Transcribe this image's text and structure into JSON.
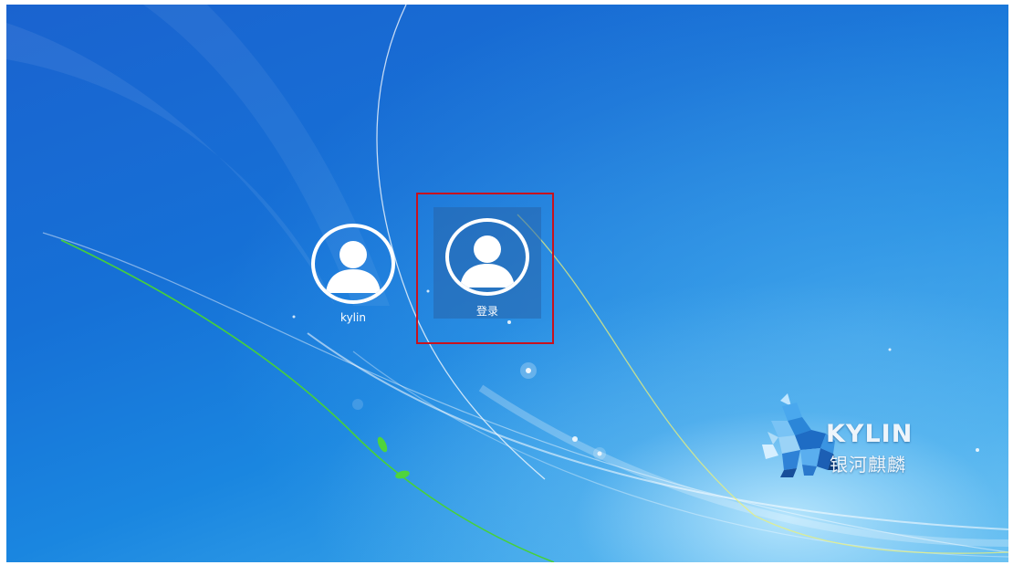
{
  "users": [
    {
      "name": "kylin",
      "icon": "user-avatar-icon"
    },
    {
      "name": "登录",
      "icon": "user-avatar-icon",
      "selected": true
    }
  ],
  "brand": {
    "name": "KYLIN",
    "name_cn": "银河麒麟",
    "logo_icon": "kylin-unicorn-logo"
  },
  "colors": {
    "highlight_border": "#c8121e",
    "background_primary": "#1670d6",
    "background_light": "#6cc3f1",
    "accent_leaf": "#3fd23a"
  }
}
